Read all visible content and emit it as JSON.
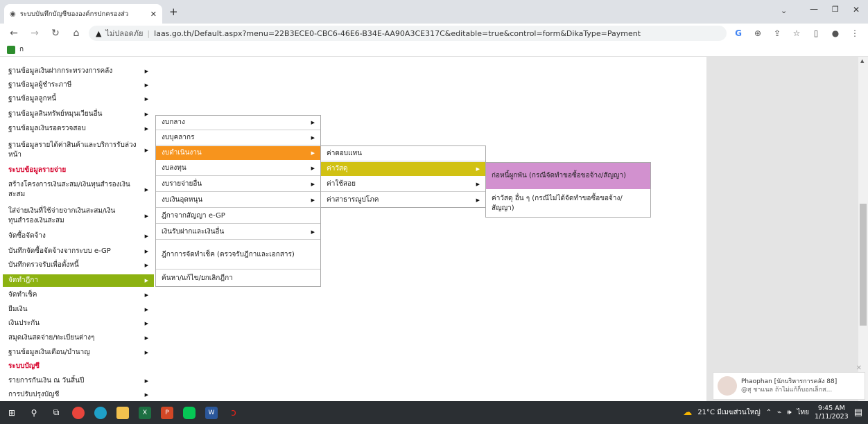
{
  "browser": {
    "tab_title": "ระบบบันทึกบัญชีขององค์กรปกครองส่ว",
    "url_security": "ไม่ปลอดภัย",
    "url": "laas.go.th/Default.aspx?menu=22B3ECE0-CBC6-46E6-B34E-AA90A3CE317C&editable=true&control=form&DikaType=Payment",
    "bookmark_label": "ก"
  },
  "menu_l1": {
    "items": [
      {
        "label": "ฐานข้อมูลเงินฝากกระทรวงการคลัง",
        "arrow": true
      },
      {
        "label": "ฐานข้อมูลผู้ชำระภาษี",
        "arrow": true
      },
      {
        "label": "ฐานข้อมูลลูกหนี้",
        "arrow": true
      },
      {
        "label": "ฐานข้อมูลสินทรัพย์หมุนเวียนอื่น",
        "arrow": true
      },
      {
        "label": "ฐานข้อมูลเงินรอตรวจสอบ",
        "arrow": true
      },
      {
        "label": "ฐานข้อมูลรายได้ค่าสินค้าและบริการรับล่วงหน้า",
        "arrow": true
      },
      {
        "label": "ระบบข้อมูลรายจ่าย",
        "header": true
      },
      {
        "label": "สร้างโครงการเงินสะสม/เงินทุนสำรองเงินสะสม",
        "arrow": true
      },
      {
        "label": "ใส่จ่ายเงินที่ใช้จ่ายจากเงินสะสม/เงินทุนสำรองเงินสะสม",
        "arrow": true
      },
      {
        "label": "จัดซื้อจัดจ้าง",
        "arrow": true
      },
      {
        "label": "บันทึกจัดซื้อจัดจ้างจากระบบ e-GP",
        "arrow": true
      },
      {
        "label": "บันทึกตรวจรับเพื่อตั้งหนี้",
        "arrow": true
      },
      {
        "label": "จัดทำฎีกา",
        "arrow": true,
        "active": true
      },
      {
        "label": "จัดทำเช็ค",
        "arrow": true
      },
      {
        "label": "ยืมเงิน",
        "arrow": true
      },
      {
        "label": "เงินประกัน",
        "arrow": true
      },
      {
        "label": "สมุดเงินสดจ่าย/ทะเบียนต่างๆ",
        "arrow": true
      },
      {
        "label": "ฐานข้อมูลเงินเดือน/บำนาญ",
        "arrow": true
      },
      {
        "label": "ระบบบัญชี",
        "header": true
      },
      {
        "label": "รายการกันเงิน ณ วันสิ้นปี",
        "arrow": true
      },
      {
        "label": "การปรับปรุงบัญชี",
        "arrow": true
      }
    ]
  },
  "menu_l2": {
    "items": [
      {
        "label": "งบกลาง",
        "arrow": true
      },
      {
        "label": "งบบุคลากร",
        "arrow": true
      },
      {
        "label": "งบดำเนินงาน",
        "arrow": true,
        "active": true
      },
      {
        "label": "งบลงทุน",
        "arrow": true
      },
      {
        "label": "งบรายจ่ายอื่น",
        "arrow": true
      },
      {
        "label": "งบเงินอุดหนุน",
        "arrow": true
      },
      {
        "label": "ฎีกาจากสัญญา e-GP",
        "arrow": false
      },
      {
        "label": "เงินรับฝากและเงินอื่น",
        "arrow": true
      },
      {
        "label": "ฎีกาการจัดทำเช็ค (ตรวจรับฎีกาและเอกสาร)",
        "arrow": false
      },
      {
        "label": "ค้นหา/แก้ไข/ยกเลิกฎีกา",
        "arrow": false
      }
    ]
  },
  "menu_l3": {
    "items": [
      {
        "label": "ค่าตอบแทน",
        "arrow": false
      },
      {
        "label": "ค่าวัสดุ",
        "arrow": true,
        "active": true
      },
      {
        "label": "ค่าใช้สอย",
        "arrow": true
      },
      {
        "label": "ค่าสาธารณูปโภค",
        "arrow": true
      }
    ]
  },
  "menu_l4": {
    "items": [
      {
        "label": "ก่อหนี้ผูกพัน (กรณีจัดทำขอซื้อขอจ้าง/สัญญา)",
        "active": true
      },
      {
        "label": "ค่าวัสดุ อื่น ๆ (กรณีไม่ได้จัดทำขอซื้อขอจ้าง/สัญญา)"
      }
    ]
  },
  "notification": {
    "title": "Phaophan [นักบริหารการคลัง 88]",
    "body": "@สุ ชาแนล ถ้าไม่แก้ก็บอกเล็กส..."
  },
  "taskbar": {
    "weather": "21°C มีเมฆส่วนใหญ่",
    "lang": "ไทย",
    "time": "9:45 AM",
    "date": "1/11/2023"
  },
  "colors": {
    "active_green": "#8cb211",
    "active_orange": "#f7941d",
    "active_yellow": "#d1c113",
    "active_pink": "#d291cf",
    "header_red": "#d6002a"
  }
}
